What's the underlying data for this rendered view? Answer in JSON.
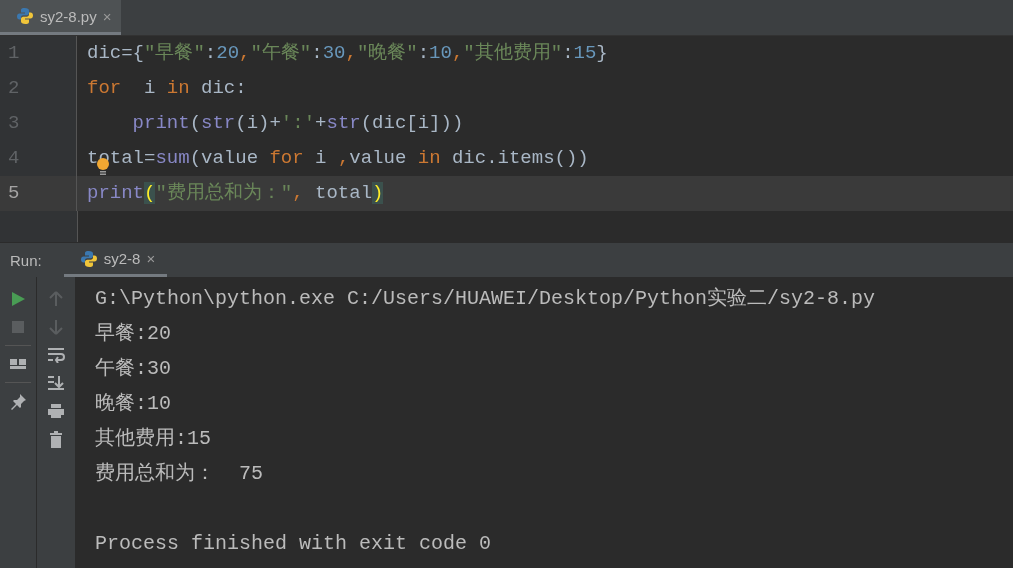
{
  "editor_tabs": [
    {
      "label": "sy2-8.py",
      "close_glyph": "×",
      "selected": true
    }
  ],
  "code_lines": [
    {
      "number": "1",
      "current": false,
      "tokens": [
        {
          "t": "dic={",
          "kind": "plain"
        },
        {
          "t": "\"早餐\"",
          "kind": "str"
        },
        {
          "t": ":",
          "kind": "plain"
        },
        {
          "t": "20",
          "kind": "num"
        },
        {
          "t": ",",
          "kind": "kw"
        },
        {
          "t": "\"午餐\"",
          "kind": "str"
        },
        {
          "t": ":",
          "kind": "plain"
        },
        {
          "t": "30",
          "kind": "num"
        },
        {
          "t": ",",
          "kind": "kw"
        },
        {
          "t": "\"晚餐\"",
          "kind": "str"
        },
        {
          "t": ":",
          "kind": "plain"
        },
        {
          "t": "10",
          "kind": "num"
        },
        {
          "t": ",",
          "kind": "kw"
        },
        {
          "t": "\"其他费用\"",
          "kind": "str"
        },
        {
          "t": ":",
          "kind": "plain"
        },
        {
          "t": "15",
          "kind": "num"
        },
        {
          "t": "}",
          "kind": "plain"
        }
      ]
    },
    {
      "number": "2",
      "current": false,
      "tokens": [
        {
          "t": "for",
          "kind": "kw"
        },
        {
          "t": "  i ",
          "kind": "plain"
        },
        {
          "t": "in",
          "kind": "kw"
        },
        {
          "t": " dic:",
          "kind": "plain"
        }
      ]
    },
    {
      "number": "3",
      "current": false,
      "tokens": [
        {
          "t": "    print",
          "kind": "fn"
        },
        {
          "t": "(",
          "kind": "plain"
        },
        {
          "t": "str",
          "kind": "fn"
        },
        {
          "t": "(i)+",
          "kind": "plain"
        },
        {
          "t": "':'",
          "kind": "str"
        },
        {
          "t": "+",
          "kind": "plain"
        },
        {
          "t": "str",
          "kind": "fn"
        },
        {
          "t": "(dic[i]))",
          "kind": "plain"
        }
      ]
    },
    {
      "number": "4",
      "current": false,
      "tokens": [
        {
          "t": "total=",
          "kind": "plain"
        },
        {
          "t": "sum",
          "kind": "fn"
        },
        {
          "t": "(value ",
          "kind": "plain"
        },
        {
          "t": "for",
          "kind": "kw"
        },
        {
          "t": " i ",
          "kind": "plain"
        },
        {
          "t": ",",
          "kind": "kw"
        },
        {
          "t": "value ",
          "kind": "plain"
        },
        {
          "t": "in",
          "kind": "kw"
        },
        {
          "t": " dic.items())",
          "kind": "plain"
        }
      ]
    },
    {
      "number": "5",
      "current": true,
      "tokens": [
        {
          "t": "print",
          "kind": "fn"
        },
        {
          "t": "(",
          "kind": "match"
        },
        {
          "t": "\"费用总和为：\"",
          "kind": "str"
        },
        {
          "t": ",",
          "kind": "kw"
        },
        {
          "t": " total",
          "kind": "plain"
        },
        {
          "t": ")",
          "kind": "match"
        }
      ]
    }
  ],
  "run_panel": {
    "label": "Run:",
    "tabs": [
      {
        "label": "sy2-8",
        "close_glyph": "×",
        "selected": true
      }
    ],
    "console_lines": [
      {
        "text": "G:\\Python\\python.exe C:/Users/HUAWEI/Desktop/Python实验二/sy2-8.py",
        "kind": "output"
      },
      {
        "text": "早餐:20",
        "kind": "output"
      },
      {
        "text": "午餐:30",
        "kind": "output"
      },
      {
        "text": "晚餐:10",
        "kind": "output"
      },
      {
        "text": "其他费用:15",
        "kind": "output"
      },
      {
        "text": "费用总和为：  75",
        "kind": "output"
      },
      {
        "text": "Process finished with exit code 0",
        "kind": "exit"
      }
    ]
  }
}
